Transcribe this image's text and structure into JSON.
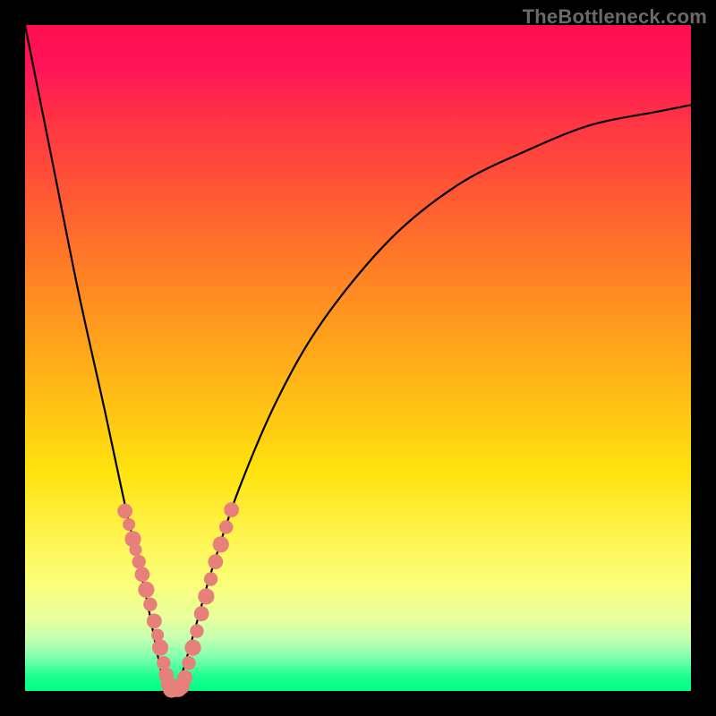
{
  "watermark": "TheBottleneck.com",
  "colors": {
    "frame": "#000000",
    "curve": "#000000",
    "marker_fill": "#e77f7a",
    "marker_stroke": "#d66862"
  },
  "chart_data": {
    "type": "line",
    "title": "",
    "xlabel": "",
    "ylabel": "",
    "xlim": [
      0,
      100
    ],
    "ylim": [
      0,
      100
    ],
    "grid": false,
    "series": [
      {
        "name": "bottleneck-curve",
        "description": "V-shaped curve; y ≈ 0 near x ≈ 22 (optimal), rising steeply on both sides",
        "x": [
          0,
          4,
          8,
          12,
          15,
          18,
          20,
          21,
          22,
          23,
          24,
          26,
          28,
          32,
          38,
          45,
          55,
          65,
          75,
          85,
          95,
          100
        ],
        "y": [
          100,
          80,
          60,
          42,
          28,
          15,
          5,
          1,
          0,
          1,
          4,
          11,
          18,
          30,
          44,
          56,
          68,
          76,
          81,
          85,
          87,
          88
        ]
      }
    ],
    "markers": {
      "description": "Clustered dots along both arms of the V near the bottom",
      "points": [
        {
          "x": 15.0,
          "y": 27.0,
          "r": 1.2
        },
        {
          "x": 15.6,
          "y": 25.0,
          "r": 1.0
        },
        {
          "x": 16.2,
          "y": 22.8,
          "r": 1.3
        },
        {
          "x": 16.6,
          "y": 21.2,
          "r": 1.0
        },
        {
          "x": 17.1,
          "y": 19.4,
          "r": 1.1
        },
        {
          "x": 17.6,
          "y": 17.5,
          "r": 1.2
        },
        {
          "x": 18.2,
          "y": 15.2,
          "r": 1.3
        },
        {
          "x": 18.8,
          "y": 13.0,
          "r": 1.1
        },
        {
          "x": 19.4,
          "y": 10.5,
          "r": 1.2
        },
        {
          "x": 19.9,
          "y": 8.4,
          "r": 1.0
        },
        {
          "x": 20.3,
          "y": 6.5,
          "r": 1.3
        },
        {
          "x": 20.8,
          "y": 4.2,
          "r": 1.1
        },
        {
          "x": 21.2,
          "y": 2.4,
          "r": 1.2
        },
        {
          "x": 21.6,
          "y": 1.0,
          "r": 1.3
        },
        {
          "x": 22.0,
          "y": 0.3,
          "r": 1.4
        },
        {
          "x": 22.5,
          "y": 0.3,
          "r": 1.3
        },
        {
          "x": 23.0,
          "y": 0.4,
          "r": 1.4
        },
        {
          "x": 23.5,
          "y": 0.7,
          "r": 1.3
        },
        {
          "x": 24.0,
          "y": 2.0,
          "r": 1.2
        },
        {
          "x": 24.6,
          "y": 4.2,
          "r": 1.1
        },
        {
          "x": 25.2,
          "y": 6.5,
          "r": 1.3
        },
        {
          "x": 25.8,
          "y": 9.0,
          "r": 1.1
        },
        {
          "x": 26.5,
          "y": 11.6,
          "r": 1.2
        },
        {
          "x": 27.2,
          "y": 14.2,
          "r": 1.3
        },
        {
          "x": 27.9,
          "y": 16.8,
          "r": 1.1
        },
        {
          "x": 28.6,
          "y": 19.4,
          "r": 1.2
        },
        {
          "x": 29.4,
          "y": 22.0,
          "r": 1.3
        },
        {
          "x": 30.2,
          "y": 24.6,
          "r": 1.1
        },
        {
          "x": 31.0,
          "y": 27.2,
          "r": 1.2
        }
      ]
    }
  }
}
